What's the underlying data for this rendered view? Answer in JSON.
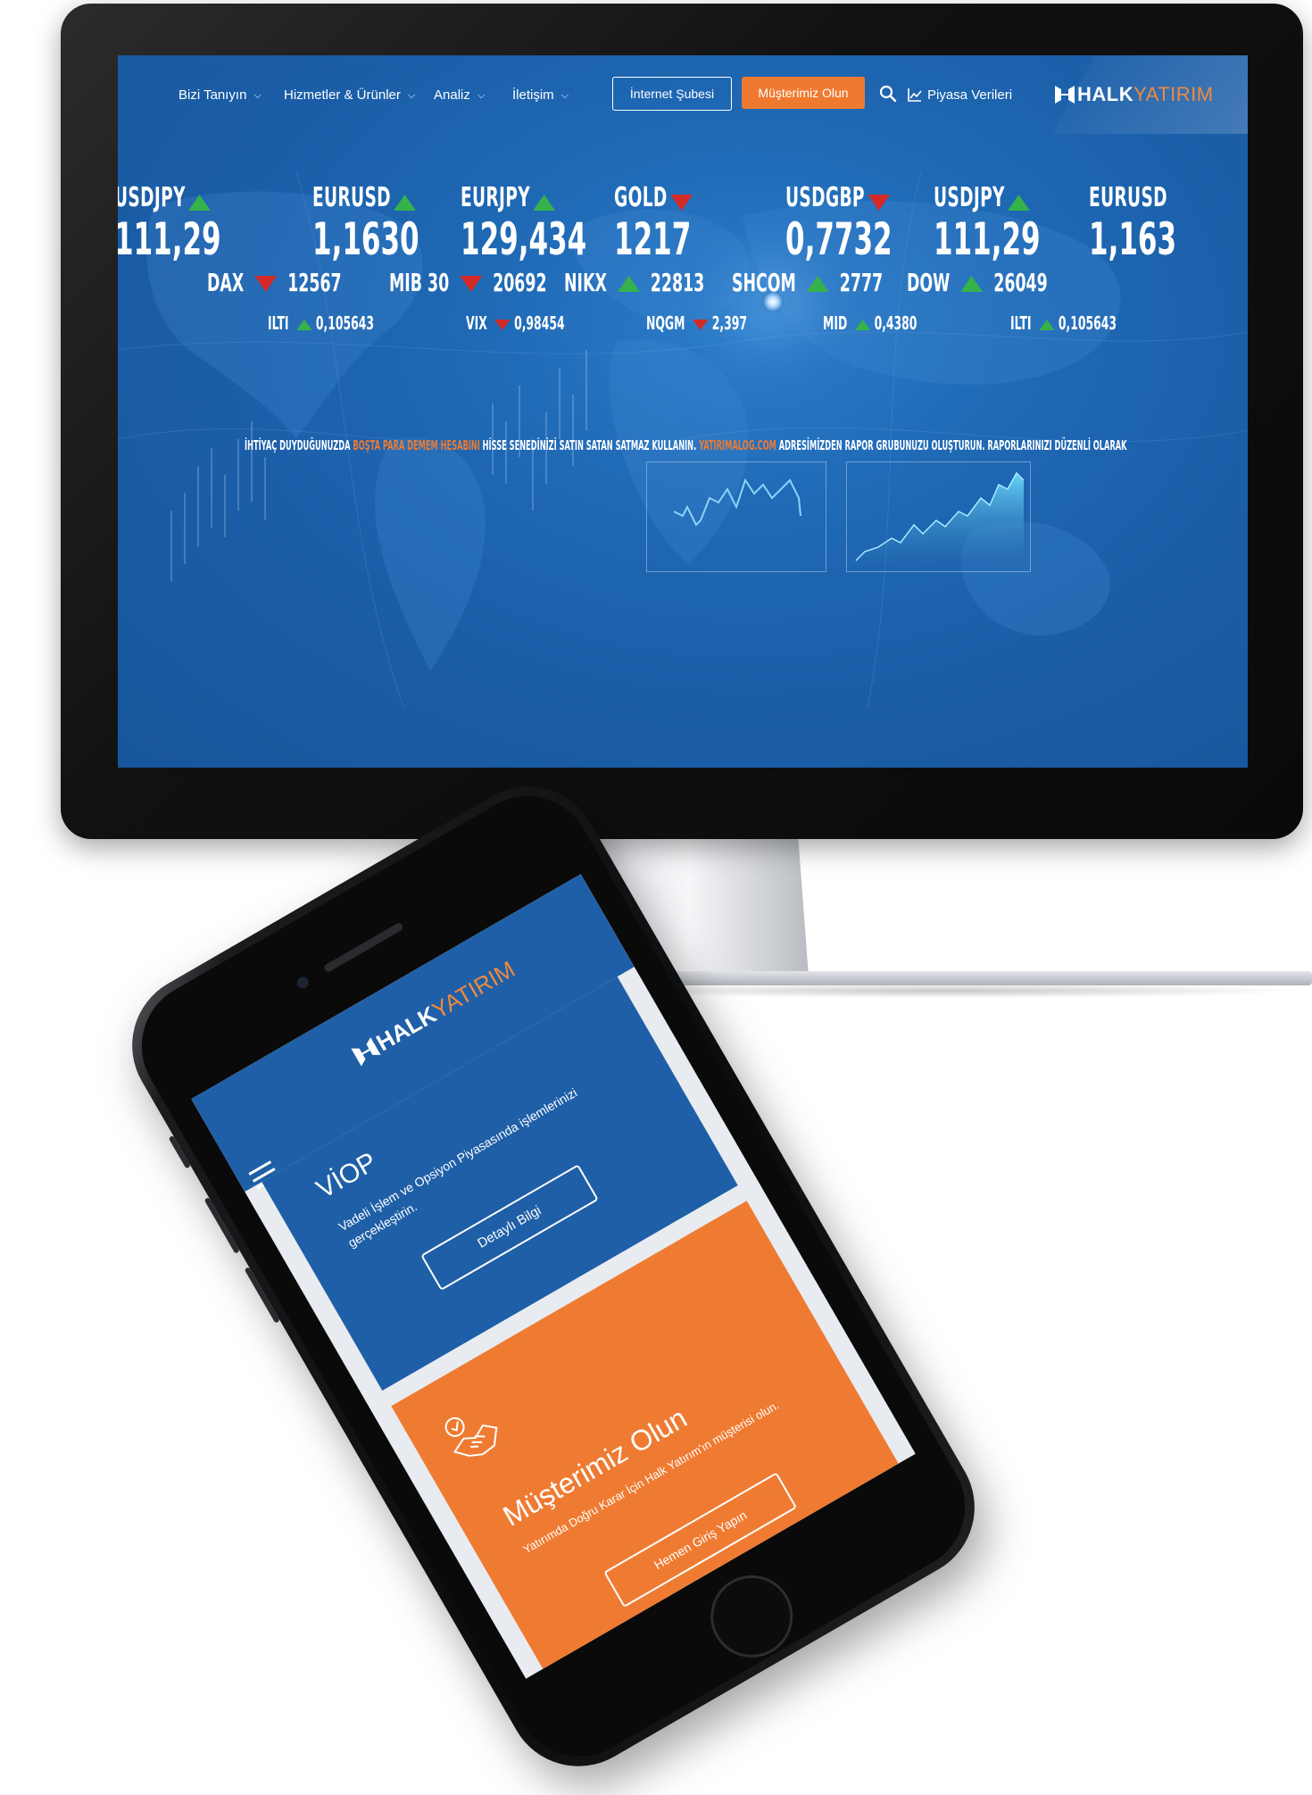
{
  "desktop": {
    "nav": {
      "items": [
        {
          "label": "Bizi Tanıyın"
        },
        {
          "label": "Hizmetler & Ürünler"
        },
        {
          "label": "Analiz"
        },
        {
          "label": "İletişim"
        }
      ],
      "internet_button": "İnternet Şubesi",
      "customer_button": "Müşterimiz Olun",
      "piyasa_link": "Piyasa Verileri",
      "brand_halk": "HALK",
      "brand_yatirim": "YATIRIM"
    },
    "ticker_row1": [
      {
        "name": "USDJPY",
        "value": "111,29",
        "direction": "up"
      },
      {
        "name": "EURUSD",
        "value": "1,1630",
        "direction": "up"
      },
      {
        "name": "EURJPY",
        "value": "129,434",
        "direction": "up"
      },
      {
        "name": "GOLD",
        "value": "1217",
        "direction": "down"
      },
      {
        "name": "USDGBP",
        "value": "0,7732",
        "direction": "down"
      },
      {
        "name": "USDJPY",
        "value": "111,29",
        "direction": "up"
      },
      {
        "name": "EURUSD",
        "value": "1,163",
        "direction": "up"
      }
    ],
    "ticker_row2": [
      {
        "name": "DAX",
        "value": "12567",
        "direction": "down"
      },
      {
        "name": "MIB 30",
        "value": "20692",
        "direction": "down"
      },
      {
        "name": "NIKX",
        "value": "22813",
        "direction": "up"
      },
      {
        "name": "SHCOM",
        "value": "2777",
        "direction": "up"
      },
      {
        "name": "DOW",
        "value": "26049",
        "direction": "up"
      }
    ],
    "ticker_row3": [
      {
        "name": "ILTI",
        "value": "0,105643",
        "direction": "up"
      },
      {
        "name": "VIX",
        "value": "0,98454",
        "direction": "down"
      },
      {
        "name": "NQGM",
        "value": "2,397",
        "direction": "down"
      },
      {
        "name": "MID",
        "value": "0,4380",
        "direction": "up"
      },
      {
        "name": "ILTI",
        "value": "0,105643",
        "direction": "up"
      }
    ],
    "marquee": {
      "part1": "İHTİYAÇ DUYDUĞUNUZDA ",
      "highlight1": "BOŞTA PARA DEMEM HESABINI",
      "part2": " HİSSE SENEDİNİZİ SATIN SATAN SATMAZ KULLANIN.    ",
      "highlight2": "YATIRIMALOG.COM",
      "part3": " ADRESİMİZDEN RAPOR GRUBUNUZU OLUŞTURUN. RAPORLARINIZI DÜZENLİ OLARAK"
    }
  },
  "mobile": {
    "brand_halk": "HALK",
    "brand_yatirim": "YATIRIM",
    "viop_title": "VİOP",
    "viop_desc": "Vadeli İşlem ve Opsiyon Piyasasında işlemlerinizi gerçekleştirin.",
    "viop_button": "Detaylı Bilgi",
    "customer_title": "Müşterimiz Olun",
    "customer_desc": "Yatırımda Doğru Karar İçin Halk Yatırım'ın müşterisi olun.",
    "customer_button": "Hemen Giriş Yapın"
  },
  "colors": {
    "brand_blue": "#1f5fa7",
    "accent_orange": "#ee7a30",
    "up_green": "#35b34a",
    "down_red": "#d42a27"
  }
}
